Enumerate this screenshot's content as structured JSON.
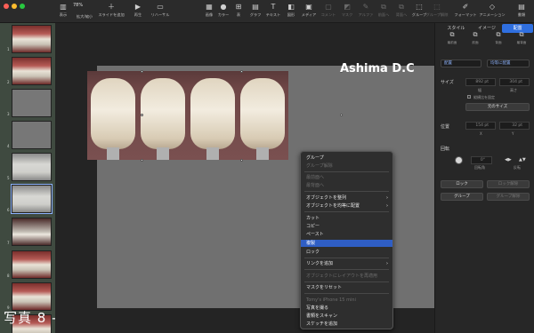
{
  "toolbar": {
    "zoom": "78%",
    "tools": [
      {
        "icon": "sidebar-icon",
        "label": "表示"
      },
      {
        "icon": "zoom-icon",
        "label": "拡大/縮小"
      },
      {
        "icon": "plus-icon",
        "label": "スライドを追加"
      },
      {
        "icon": "play-icon",
        "label": "再生"
      },
      {
        "icon": "rehearse-icon",
        "label": "リハーサル"
      },
      {
        "icon": "table-icon",
        "label": "表"
      },
      {
        "icon": "chart-icon",
        "label": "グラフ"
      },
      {
        "icon": "text-icon",
        "label": "テキスト"
      },
      {
        "icon": "shape-icon",
        "label": "図形"
      },
      {
        "icon": "media-icon",
        "label": "メディア"
      },
      {
        "icon": "comment-icon",
        "label": "コメント"
      },
      {
        "icon": "mask-icon",
        "label": "マスク"
      },
      {
        "icon": "alpha-icon",
        "label": "アルファ"
      },
      {
        "icon": "front-icon",
        "label": "前面へ"
      },
      {
        "icon": "back-icon",
        "label": "背面へ"
      },
      {
        "icon": "group-icon",
        "label": "グループ"
      },
      {
        "icon": "ungroup-icon",
        "label": "グループ解除"
      },
      {
        "icon": "format-icon",
        "label": "フォーマット"
      },
      {
        "icon": "animate-icon",
        "label": "アニメーション"
      },
      {
        "icon": "document-icon",
        "label": "書類"
      }
    ],
    "mid_labels": [
      "画像",
      "カラー",
      "表"
    ]
  },
  "navigator": {
    "slides": [
      "1",
      "2",
      "3",
      "4",
      "5",
      "6",
      "7",
      "8",
      "9",
      "10"
    ],
    "caption": "写真 8 -K"
  },
  "canvas": {
    "title": "Ashima D.C"
  },
  "context_menu": {
    "items": [
      {
        "label": "グループ",
        "disabled": false
      },
      {
        "label": "グループ解除",
        "disabled": true
      },
      {
        "label": "最前面へ",
        "disabled": true
      },
      {
        "label": "最背面へ",
        "disabled": true
      },
      {
        "label": "オブジェクトを整列",
        "disabled": false,
        "submenu": true
      },
      {
        "label": "オブジェクトを均等に配置",
        "disabled": false,
        "submenu": true
      },
      {
        "label": "カット",
        "disabled": false
      },
      {
        "label": "コピー",
        "disabled": false
      },
      {
        "label": "ペースト",
        "disabled": false
      },
      {
        "label": "複製",
        "disabled": false,
        "highlighted": true
      },
      {
        "label": "ロック",
        "disabled": false
      },
      {
        "label": "リンクを追加",
        "disabled": false,
        "submenu": true
      },
      {
        "label": "オブジェクトにレイアウトを再適用",
        "disabled": true
      },
      {
        "label": "マスクをリセット",
        "disabled": false
      },
      {
        "label": "Tomy's iPhone 15 mini",
        "disabled": true
      },
      {
        "label": "写真を撮る",
        "disabled": false
      },
      {
        "label": "書類をスキャン",
        "disabled": false
      },
      {
        "label": "スケッチを追加",
        "disabled": false
      }
    ]
  },
  "inspector": {
    "tabs": [
      "スタイル",
      "イメージ",
      "配置"
    ],
    "active_tab": "配置",
    "align_items": [
      "最前面",
      "前面",
      "背面",
      "最背面"
    ],
    "align_select": "配置",
    "distribute_select": "均等に配置",
    "size_label": "サイズ",
    "width_value": "892 pt",
    "height_value": "304 pt",
    "width_caption": "幅",
    "height_caption": "高さ",
    "constrain_label": "縦横比を固定",
    "original_size_button": "元のサイズ",
    "position_label": "位置",
    "x_value": "154 pt",
    "y_value": "32 pt",
    "x_caption": "X",
    "y_caption": "Y",
    "rotate_label": "回転",
    "angle_value": "0°",
    "angle_caption": "回転角",
    "flip_caption": "反転",
    "lock_button": "ロック",
    "unlock_button": "ロック解除",
    "group_button": "グループ",
    "ungroup_button": "グループ解除"
  }
}
